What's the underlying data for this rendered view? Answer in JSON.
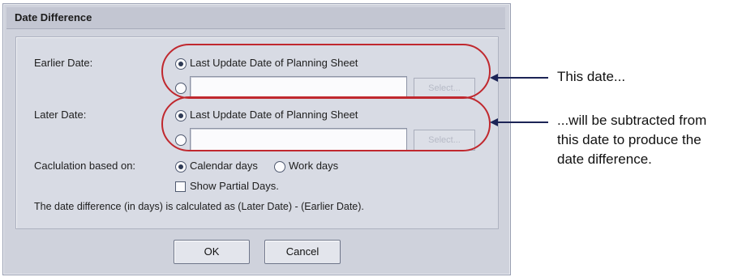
{
  "dialog": {
    "title": "Date Difference",
    "earlier_date": {
      "label": "Earlier Date:",
      "option_text": "Last Update Date of Planning Sheet",
      "field_value": "",
      "select_label": "Select..."
    },
    "later_date": {
      "label": "Later Date:",
      "option_text": "Last Update Date of Planning Sheet",
      "field_value": "",
      "select_label": "Select..."
    },
    "calc": {
      "label": "Caclulation based on:",
      "calendar": "Calendar days",
      "work": "Work days",
      "partial": "Show Partial Days."
    },
    "info": "The date difference (in days) is calculated as (Later Date) - (Earlier Date).",
    "ok": "OK",
    "cancel": "Cancel"
  },
  "annotations": {
    "first": "This date...",
    "second": [
      "...will be subtracted from",
      "this date to produce the",
      "date difference."
    ]
  },
  "colors": {
    "highlight_ellipse": "#c0282e",
    "arrow": "#1c2456"
  }
}
